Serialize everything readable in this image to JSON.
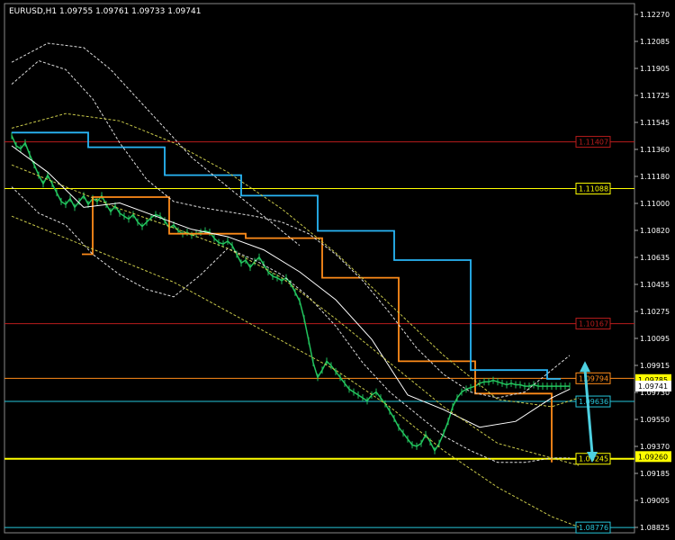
{
  "header": {
    "symbol_text": "EURUSD,H1",
    "ohlc_text": "1.09755 1.09761 1.09733 1.09741"
  },
  "chart_data": {
    "type": "line",
    "title": "EURUSD,H1",
    "ylim": [
      1.0874,
      1.1235
    ],
    "grid": false,
    "colors": {
      "background": "#000000",
      "candles": "#22c55e",
      "resistance_red": "#b91c1c",
      "level_yellow": "#ffff00",
      "level_cyan": "#26c6da",
      "stop_orange": "#ff8c1a",
      "stop_blue": "#29b6f6",
      "band_dashed": "#dddddd",
      "band_outer": "#c9c94a",
      "ma_white": "#ffffff",
      "arrow": "#4dd0e1",
      "axis_text": "#ffffff"
    },
    "y_ticks": [
      "1.12270",
      "1.12085",
      "1.11905",
      "1.11725",
      "1.11545",
      "1.11360",
      "1.11180",
      "1.11000",
      "1.10820",
      "1.10635",
      "1.10455",
      "1.10275",
      "1.10095",
      "1.09915",
      "1.09730",
      "1.09550",
      "1.09370",
      "1.09185",
      "1.09005",
      "1.08825"
    ],
    "levels": [
      {
        "label": "1.11407",
        "value": 1.11407,
        "color": "#b91c1c",
        "label_style": "boxed"
      },
      {
        "label": "1.11088",
        "value": 1.11088,
        "color": "#ffff00",
        "label_style": "boxed"
      },
      {
        "label": "1.10167",
        "value": 1.10167,
        "color": "#b91c1c",
        "label_style": "boxed"
      },
      {
        "label": "1.09794",
        "value": 1.09794,
        "color": "#ff8c1a",
        "label_style": "boxed"
      },
      {
        "label": "1.09636",
        "value": 1.09636,
        "color": "#26c6da",
        "label_style": "boxed"
      },
      {
        "label": "1.09245",
        "value": 1.09245,
        "color": "#ffff00",
        "label_style": "boxed"
      },
      {
        "label": "1.08776",
        "value": 1.08776,
        "color": "#26c6da",
        "label_style": "boxed"
      }
    ],
    "axis_markers": [
      {
        "label": "1.09785",
        "value": 1.09785,
        "bg": "#ffff00",
        "fg": "#000000"
      },
      {
        "label": "1.09741",
        "value": 1.09741,
        "bg": "#ffffff",
        "fg": "#000000"
      },
      {
        "label": "1.09260",
        "value": 1.0926,
        "bg": "#ffff00",
        "fg": "#000000"
      }
    ],
    "series": [
      {
        "kind": "price",
        "color": "#22c55e",
        "x": [
          0,
          5,
          10,
          15,
          20,
          25,
          30,
          35,
          40,
          45,
          50,
          55,
          60,
          65,
          70,
          75,
          80,
          85,
          90,
          95,
          100,
          105,
          110,
          115,
          120,
          125,
          130,
          135,
          140,
          145,
          150,
          155,
          160,
          165,
          170,
          175,
          180,
          185,
          190,
          195,
          200,
          205,
          210,
          215,
          220,
          225,
          230,
          235,
          240,
          245,
          250,
          255,
          260,
          265,
          270,
          275,
          280,
          285,
          290,
          295,
          300,
          305,
          310,
          315,
          320,
          325,
          330,
          335,
          340,
          345,
          350,
          355,
          360,
          365,
          370,
          375,
          380,
          385,
          390,
          395,
          400,
          405,
          410,
          415,
          420,
          425,
          430,
          435,
          440,
          445,
          450,
          455,
          460,
          465,
          470,
          475,
          480,
          485,
          490,
          495,
          500,
          505,
          510,
          515,
          520,
          525,
          530,
          535,
          540,
          545,
          550,
          555,
          560,
          565,
          570,
          575,
          580,
          585,
          590,
          595,
          600,
          605,
          610,
          615,
          620
        ],
        "y": [
          1.1145,
          1.1138,
          1.1136,
          1.114,
          1.1132,
          1.1125,
          1.1118,
          1.1112,
          1.1118,
          1.1112,
          1.1106,
          1.11,
          1.1098,
          1.1102,
          1.1096,
          1.11,
          1.1104,
          1.1098,
          1.1102,
          1.11,
          1.1104,
          1.1098,
          1.1093,
          1.1097,
          1.1092,
          1.109,
          1.1088,
          1.1091,
          1.1086,
          1.1083,
          1.1086,
          1.1089,
          1.1091,
          1.109,
          1.1087,
          1.1082,
          1.1084,
          1.108,
          1.1078,
          1.1079,
          1.1077,
          1.1078,
          1.1079,
          1.108,
          1.1079,
          1.1075,
          1.1072,
          1.1071,
          1.1073,
          1.107,
          1.1064,
          1.1058,
          1.106,
          1.1055,
          1.1059,
          1.1062,
          1.1057,
          1.1052,
          1.1049,
          1.1048,
          1.1046,
          1.1048,
          1.1044,
          1.1038,
          1.1032,
          1.102,
          1.1005,
          1.099,
          1.098,
          1.0985,
          1.0991,
          1.0988,
          1.0984,
          1.098,
          1.0976,
          1.0972,
          1.097,
          1.0968,
          1.0966,
          1.0964,
          1.0968,
          1.097,
          1.0966,
          1.0962,
          1.0957,
          1.0952,
          1.0946,
          1.0942,
          1.0938,
          1.0934,
          1.0933,
          1.0935,
          1.0941,
          1.0936,
          1.093,
          1.0935,
          1.0942,
          1.095,
          1.096,
          1.0966,
          1.097,
          1.0972,
          1.0973,
          1.0974,
          1.0976,
          1.0977,
          1.0977,
          1.0978,
          1.0977,
          1.0976,
          1.0975,
          1.0976,
          1.0975,
          1.0975,
          1.0974,
          1.0974,
          1.0975,
          1.0974,
          1.0974,
          1.0974,
          1.0974,
          1.0974,
          1.0974,
          1.0974,
          1.0974
        ]
      },
      {
        "kind": "stop-orange",
        "color": "#ff8c1a",
        "step": true,
        "x": [
          78,
          78,
          90,
          90,
          175,
          175,
          260,
          260,
          345,
          345,
          430,
          430,
          515,
          515,
          600,
          600
        ],
        "y": [
          1.1064,
          1.1064,
          1.1064,
          1.1103,
          1.1103,
          1.1078,
          1.1078,
          1.1075,
          1.1075,
          1.1048,
          1.1048,
          1.0991,
          1.0991,
          1.0969,
          1.0969,
          1.0922
        ]
      },
      {
        "kind": "stop-blue",
        "color": "#29b6f6",
        "step": true,
        "x": [
          0,
          0,
          85,
          85,
          170,
          170,
          255,
          255,
          340,
          340,
          425,
          425,
          510,
          510,
          595,
          595,
          610
        ],
        "y": [
          1.1147,
          1.1147,
          1.1147,
          1.1137,
          1.1137,
          1.1118,
          1.1118,
          1.1104,
          1.1104,
          1.108,
          1.108,
          1.106,
          1.106,
          1.0985,
          1.0985,
          1.0979,
          1.0979
        ]
      },
      {
        "kind": "ma",
        "color": "#ffffff",
        "x": [
          0,
          40,
          80,
          120,
          160,
          200,
          240,
          280,
          320,
          360,
          400,
          440,
          480,
          520,
          560,
          600,
          620
        ],
        "y": [
          1.1138,
          1.112,
          1.1096,
          1.1099,
          1.109,
          1.1081,
          1.1076,
          1.1067,
          1.1052,
          1.1033,
          1.1006,
          1.0968,
          1.0958,
          1.0946,
          1.095,
          1.0966,
          1.0972
        ]
      },
      {
        "kind": "band-upper",
        "color": "#dddddd",
        "dash": true,
        "x": [
          0,
          30,
          60,
          90,
          120,
          150,
          180,
          210,
          240,
          270,
          300,
          330,
          360,
          390,
          420,
          450,
          480,
          510,
          540,
          570,
          600,
          620
        ],
        "y": [
          1.118,
          1.1196,
          1.119,
          1.117,
          1.114,
          1.1115,
          1.11,
          1.1096,
          1.1093,
          1.109,
          1.1086,
          1.1078,
          1.1064,
          1.1046,
          1.1024,
          1.1,
          1.0982,
          1.097,
          1.0966,
          1.097,
          1.0985,
          1.0995
        ]
      },
      {
        "kind": "band-lower",
        "color": "#dddddd",
        "dash": true,
        "x": [
          0,
          30,
          60,
          90,
          120,
          150,
          180,
          210,
          240,
          270,
          300,
          330,
          360,
          390,
          420,
          450,
          480,
          510,
          540,
          570,
          600,
          620
        ],
        "y": [
          1.111,
          1.1092,
          1.1084,
          1.1064,
          1.105,
          1.104,
          1.1035,
          1.105,
          1.1068,
          1.106,
          1.105,
          1.1035,
          1.1015,
          1.099,
          1.097,
          1.0955,
          1.094,
          1.093,
          1.0922,
          1.0922,
          1.0925,
          1.0925
        ]
      },
      {
        "kind": "envelope-upper",
        "color": "#c9c94a",
        "dash": true,
        "x": [
          0,
          60,
          120,
          180,
          240,
          300,
          360,
          420,
          480,
          540,
          600,
          630
        ],
        "y": [
          1.115,
          1.116,
          1.1155,
          1.114,
          1.112,
          1.1095,
          1.1065,
          1.103,
          1.0995,
          1.0965,
          1.096,
          1.0966
        ]
      },
      {
        "kind": "envelope-lower",
        "color": "#c9c94a",
        "dash": true,
        "x": [
          0,
          60,
          120,
          180,
          240,
          300,
          360,
          420,
          480,
          540,
          600,
          630
        ],
        "y": [
          1.1125,
          1.111,
          1.1095,
          1.1082,
          1.1068,
          1.1048,
          1.102,
          1.099,
          1.096,
          1.0935,
          1.0925,
          1.092
        ]
      },
      {
        "kind": "outer-lower",
        "color": "#c9c94a",
        "dash": true,
        "x": [
          0,
          60,
          120,
          180,
          240,
          300,
          360,
          420,
          480,
          540,
          600,
          630
        ],
        "y": [
          1.109,
          1.1075,
          1.106,
          1.1045,
          1.1025,
          1.1005,
          1.0985,
          1.096,
          1.093,
          1.0905,
          1.0885,
          1.0878
        ]
      },
      {
        "kind": "outer-upper",
        "color": "#dddddd",
        "dash": true,
        "x": [
          0,
          40,
          80,
          110,
          140,
          170,
          200,
          230,
          260,
          290,
          320
        ],
        "y": [
          1.1195,
          1.1208,
          1.1205,
          1.119,
          1.117,
          1.115,
          1.113,
          1.1115,
          1.11,
          1.1085,
          1.107
        ]
      }
    ],
    "arrow": {
      "x": 645,
      "y_from": 1.0985,
      "y_to": 1.0928,
      "color": "#4dd0e1"
    }
  }
}
